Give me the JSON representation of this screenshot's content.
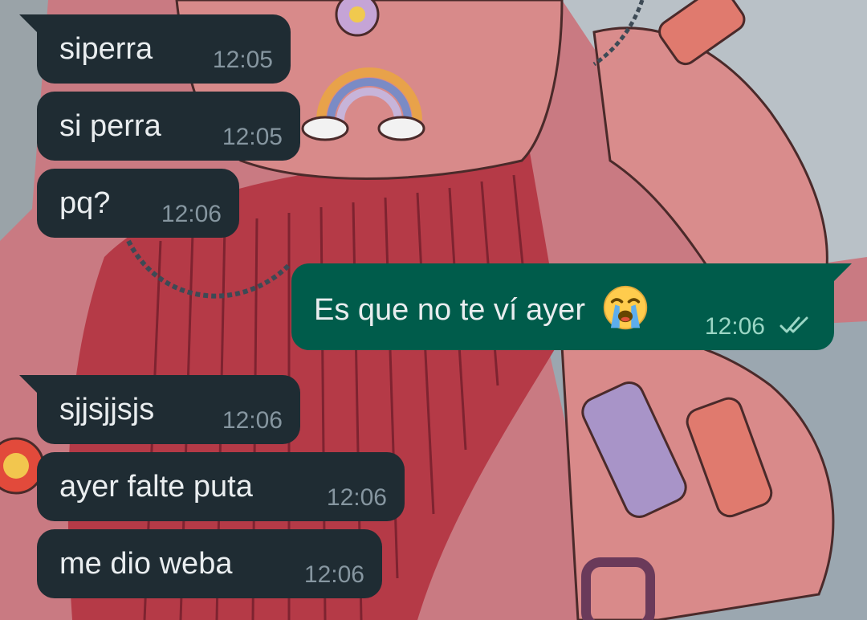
{
  "chat": {
    "messages": [
      {
        "text": "siperra",
        "time": "12:05",
        "direction": "incoming"
      },
      {
        "text": "si perra",
        "time": "12:05",
        "direction": "incoming"
      },
      {
        "text": "pq?",
        "time": "12:06",
        "direction": "incoming"
      },
      {
        "text": "Es que no te ví ayer",
        "time": "12:06",
        "direction": "outgoing",
        "emoji": "loudly-crying-face-icon",
        "status": "read"
      },
      {
        "text": "sjjsjjsjs",
        "time": "12:06",
        "direction": "incoming"
      },
      {
        "text": "ayer falte puta",
        "time": "12:06",
        "direction": "incoming"
      },
      {
        "text": "me dio weba",
        "time": "12:06",
        "direction": "incoming"
      }
    ]
  },
  "colors": {
    "incoming_bubble": "#1f2c33",
    "outgoing_bubble": "#005c4b",
    "text": "#e9edef",
    "timestamp": "#8696a0"
  }
}
